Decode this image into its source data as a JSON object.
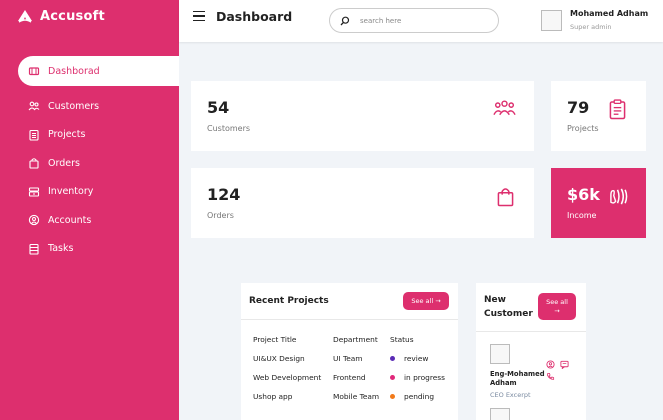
{
  "app": {
    "name": "Accusoft",
    "brand_color": "#dd2f6e"
  },
  "sidebar": {
    "items": [
      {
        "label": "Dashborad",
        "icon": "dashboard-icon",
        "active": true
      },
      {
        "label": "Customers",
        "icon": "users-icon"
      },
      {
        "label": "Projects",
        "icon": "clipboard-icon"
      },
      {
        "label": "Orders",
        "icon": "shopping-bag-icon"
      },
      {
        "label": "Inventory",
        "icon": "inventory-icon"
      },
      {
        "label": "Accounts",
        "icon": "account-circle-icon"
      },
      {
        "label": "Tasks",
        "icon": "tasks-icon"
      }
    ]
  },
  "header": {
    "title": "Dashboard",
    "search_placeholder": "search here",
    "user_name": "Mohamed Adham",
    "user_role": "Super admin"
  },
  "cards": {
    "customers": {
      "value": "54",
      "label": "Customers",
      "icon": "users-icon"
    },
    "projects": {
      "value": "79",
      "label": "Projects",
      "icon": "clipboard-icon"
    },
    "orders": {
      "value": "124",
      "label": "Orders",
      "icon": "shopping-bag-icon"
    },
    "income": {
      "value": "$6k",
      "label": "Income",
      "icon": "money-icon"
    }
  },
  "recent_projects": {
    "title": "Recent Projects",
    "see_all": "See all →",
    "columns": [
      "Project Title",
      "Department",
      "Status"
    ],
    "rows": [
      {
        "title": "UI&UX Design",
        "department": "UI Team",
        "status": "review",
        "status_color": "#5b2bb5"
      },
      {
        "title": "Web Development",
        "department": "Frontend",
        "status": "in progress",
        "status_color": "#e0287a"
      },
      {
        "title": "Ushop app",
        "department": "Mobile Team",
        "status": "pending",
        "status_color": "#f27a1a"
      }
    ]
  },
  "new_customer": {
    "title": "New Customer",
    "see_all": "See all →",
    "customer": {
      "name": "Eng-Mohamed Adham",
      "role": "CEO Excerpt"
    }
  }
}
